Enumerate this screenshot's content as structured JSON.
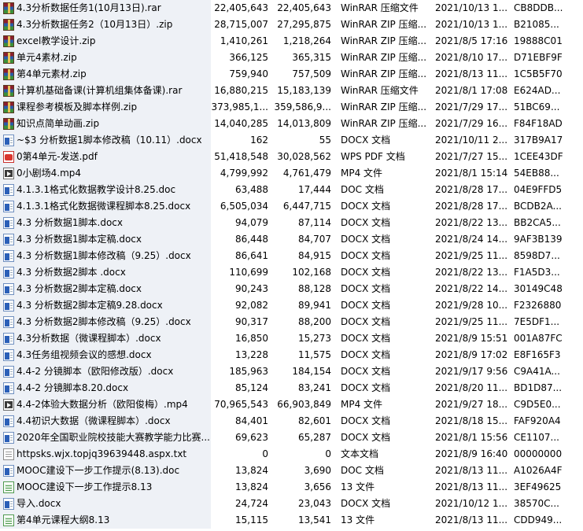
{
  "files": [
    {
      "name": "4.3分析数据任务1(10月13日).rar",
      "size": "22,405,643",
      "packed": "22,405,643",
      "type": "WinRAR 压缩文件",
      "modified": "2021/10/13 1...",
      "crc": "CB8DDB...",
      "icon": "rar-icon"
    },
    {
      "name": "4.3分析数据任务2（10月13日）.zip",
      "size": "28,715,007",
      "packed": "27,295,875",
      "type": "WinRAR ZIP 压缩...",
      "modified": "2021/10/13 1...",
      "crc": "B21085...",
      "icon": "rar-icon"
    },
    {
      "name": "excel教学设计.zip",
      "size": "1,410,261",
      "packed": "1,218,264",
      "type": "WinRAR ZIP 压缩...",
      "modified": "2021/8/5 17:16",
      "crc": "19888C01",
      "icon": "rar-icon"
    },
    {
      "name": "单元4素材.zip",
      "size": "366,125",
      "packed": "365,315",
      "type": "WinRAR ZIP 压缩...",
      "modified": "2021/8/10 17...",
      "crc": "D71EBF9F",
      "icon": "rar-icon"
    },
    {
      "name": "第4单元素材.zip",
      "size": "759,940",
      "packed": "757,509",
      "type": "WinRAR ZIP 压缩...",
      "modified": "2021/8/13 11...",
      "crc": "1C5B5F70",
      "icon": "rar-icon"
    },
    {
      "name": "计算机基础备课(计算机组集体备课).rar",
      "size": "16,880,215",
      "packed": "15,183,139",
      "type": "WinRAR 压缩文件",
      "modified": "2021/8/1 17:08",
      "crc": "E624AD...",
      "icon": "rar-icon"
    },
    {
      "name": "课程参考模板及脚本样例.zip",
      "size": "373,985,1...",
      "packed": "359,586,9...",
      "type": "WinRAR ZIP 压缩...",
      "modified": "2021/7/29 17...",
      "crc": "51BC69...",
      "icon": "rar-icon"
    },
    {
      "name": "知识点简单动画.zip",
      "size": "14,040,285",
      "packed": "14,013,809",
      "type": "WinRAR ZIP 压缩...",
      "modified": "2021/7/29 16...",
      "crc": "F84F18AD",
      "icon": "rar-icon"
    },
    {
      "name": "~$3 分析数据1脚本修改稿（10.11）.docx",
      "size": "162",
      "packed": "55",
      "type": "DOCX 文档",
      "modified": "2021/10/11 2...",
      "crc": "317B9A17",
      "icon": "word-doc-icon"
    },
    {
      "name": "0第4单元-发送.pdf",
      "size": "51,418,548",
      "packed": "30,028,562",
      "type": "WPS PDF 文档",
      "modified": "2021/7/27 15...",
      "crc": "1CEE43DF",
      "icon": "pdf-icon"
    },
    {
      "name": "0小剧场4.mp4",
      "size": "4,799,992",
      "packed": "4,761,479",
      "type": "MP4 文件",
      "modified": "2021/8/1 15:14",
      "crc": "54EB88...",
      "icon": "video-icon"
    },
    {
      "name": "4.1.3.1格式化数据教学设计8.25.doc",
      "size": "63,488",
      "packed": "17,444",
      "type": "DOC 文档",
      "modified": "2021/8/28 17...",
      "crc": "04E9FFD5",
      "icon": "word-doc-icon"
    },
    {
      "name": "4.1.3.1格式化数据微课程脚本8.25.docx",
      "size": "6,505,034",
      "packed": "6,447,715",
      "type": "DOCX 文档",
      "modified": "2021/8/28 17...",
      "crc": "BCDB2A...",
      "icon": "word-doc-icon"
    },
    {
      "name": "4.3 分析数据1脚本.docx",
      "size": "94,079",
      "packed": "87,114",
      "type": "DOCX 文档",
      "modified": "2021/8/22 13...",
      "crc": "BB2CA5...",
      "icon": "word-doc-icon"
    },
    {
      "name": "4.3 分析数据1脚本定稿.docx",
      "size": "86,448",
      "packed": "84,707",
      "type": "DOCX 文档",
      "modified": "2021/8/24 14...",
      "crc": "9AF3B139",
      "icon": "word-doc-icon"
    },
    {
      "name": "4.3 分析数据1脚本修改稿（9.25）.docx",
      "size": "86,641",
      "packed": "84,915",
      "type": "DOCX 文档",
      "modified": "2021/9/25 11...",
      "crc": "8598D7...",
      "icon": "word-doc-icon"
    },
    {
      "name": "4.3 分析数据2脚本 .docx",
      "size": "110,699",
      "packed": "102,168",
      "type": "DOCX 文档",
      "modified": "2021/8/22 13...",
      "crc": "F1A5D3...",
      "icon": "word-doc-icon"
    },
    {
      "name": "4.3 分析数据2脚本定稿.docx",
      "size": "90,243",
      "packed": "88,128",
      "type": "DOCX 文档",
      "modified": "2021/8/22 14...",
      "crc": "30149C48",
      "icon": "word-doc-icon"
    },
    {
      "name": "4.3 分析数据2脚本定稿9.28.docx",
      "size": "92,082",
      "packed": "89,941",
      "type": "DOCX 文档",
      "modified": "2021/9/28 10...",
      "crc": "F2326880",
      "icon": "word-doc-icon"
    },
    {
      "name": "4.3 分析数据2脚本修改稿（9.25）.docx",
      "size": "90,317",
      "packed": "88,200",
      "type": "DOCX 文档",
      "modified": "2021/9/25 11...",
      "crc": "7E5DF1...",
      "icon": "word-doc-icon"
    },
    {
      "name": "4.3分析数据（微课程脚本）.docx",
      "size": "16,850",
      "packed": "15,273",
      "type": "DOCX 文档",
      "modified": "2021/8/9 15:51",
      "crc": "001A87FC",
      "icon": "word-doc-icon"
    },
    {
      "name": "4.3任务组视频会议的感想.docx",
      "size": "13,228",
      "packed": "11,575",
      "type": "DOCX 文档",
      "modified": "2021/8/9 17:02",
      "crc": "E8F165F3",
      "icon": "word-doc-icon"
    },
    {
      "name": "4.4-2 分镜脚本（欧阳修改版）.docx",
      "size": "185,963",
      "packed": "184,154",
      "type": "DOCX 文档",
      "modified": "2021/9/17 9:56",
      "crc": "C9A41A...",
      "icon": "word-doc-icon"
    },
    {
      "name": "4.4-2 分镜脚本8.20.docx",
      "size": "85,124",
      "packed": "83,241",
      "type": "DOCX 文档",
      "modified": "2021/8/20 11...",
      "crc": "BD1D87...",
      "icon": "word-doc-icon"
    },
    {
      "name": "4.4-2体验大数据分析（欧阳俊梅）.mp4",
      "size": "70,965,543",
      "packed": "66,903,849",
      "type": "MP4 文件",
      "modified": "2021/9/27 18...",
      "crc": "C9D5E0...",
      "icon": "video-icon"
    },
    {
      "name": "4.4初识大数据（微课程脚本）.docx",
      "size": "84,401",
      "packed": "82,601",
      "type": "DOCX 文档",
      "modified": "2021/8/18 15...",
      "crc": "FAF920A4",
      "icon": "word-doc-icon"
    },
    {
      "name": "2020年全国职业院校技能大赛教学能力比赛...",
      "size": "69,623",
      "packed": "65,287",
      "type": "DOCX 文档",
      "modified": "2021/8/1 15:56",
      "crc": "CE1107...",
      "icon": "word-doc-icon"
    },
    {
      "name": "httpsks.wjx.topjq39639448.aspx.txt",
      "size": "0",
      "packed": "0",
      "type": "文本文档",
      "modified": "2021/8/9 16:40",
      "crc": "00000000",
      "icon": "text-file-icon"
    },
    {
      "name": "MOOC建设下一步工作提示(8.13).doc",
      "size": "13,824",
      "packed": "3,690",
      "type": "DOC 文档",
      "modified": "2021/8/13 11...",
      "crc": "A1026A4F",
      "icon": "word-doc-icon"
    },
    {
      "name": "MOOC建设下一步工作提示8.13",
      "size": "13,824",
      "packed": "3,656",
      "type": "13 文件",
      "modified": "2021/8/13 11...",
      "crc": "3EF49625",
      "icon": "generic-file-icon"
    },
    {
      "name": "导入.docx",
      "size": "24,724",
      "packed": "23,043",
      "type": "DOCX 文档",
      "modified": "2021/10/12 1...",
      "crc": "38570C...",
      "icon": "word-doc-icon"
    },
    {
      "name": "第4单元课程大纲8.13",
      "size": "15,115",
      "packed": "13,541",
      "type": "13 文件",
      "modified": "2021/8/13 11...",
      "crc": "CDD949...",
      "icon": "generic-file-icon"
    }
  ]
}
